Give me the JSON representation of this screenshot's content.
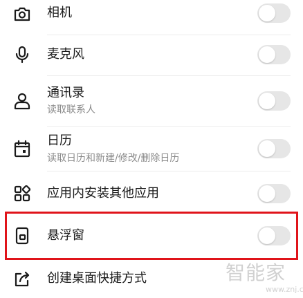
{
  "permissions": {
    "camera": {
      "label": "相机",
      "icon": "camera-icon",
      "enabled": false
    },
    "microphone": {
      "label": "麦克风",
      "icon": "microphone-icon",
      "enabled": false
    },
    "contacts": {
      "label": "通讯录",
      "description": "读取联系人",
      "icon": "person-icon",
      "enabled": false
    },
    "calendar": {
      "label": "日历",
      "description": "读取日历和新建/修改/删除日历",
      "icon": "calendar-icon",
      "enabled": false
    },
    "install_apps": {
      "label": "应用内安装其他应用",
      "icon": "apps-grid-icon",
      "enabled": false
    },
    "floating_window": {
      "label": "悬浮窗",
      "icon": "floating-window-icon",
      "enabled": false,
      "highlighted": true
    },
    "desktop_shortcut": {
      "label": "创建桌面快捷方式",
      "icon": "share-shortcut-icon"
    }
  },
  "watermark": {
    "text": "智能家",
    "url": "www.znj.com"
  },
  "colors": {
    "highlight_border": "#e0141a",
    "toggle_off": "#e6e6e6",
    "secondary_text": "#8a8a8a"
  }
}
